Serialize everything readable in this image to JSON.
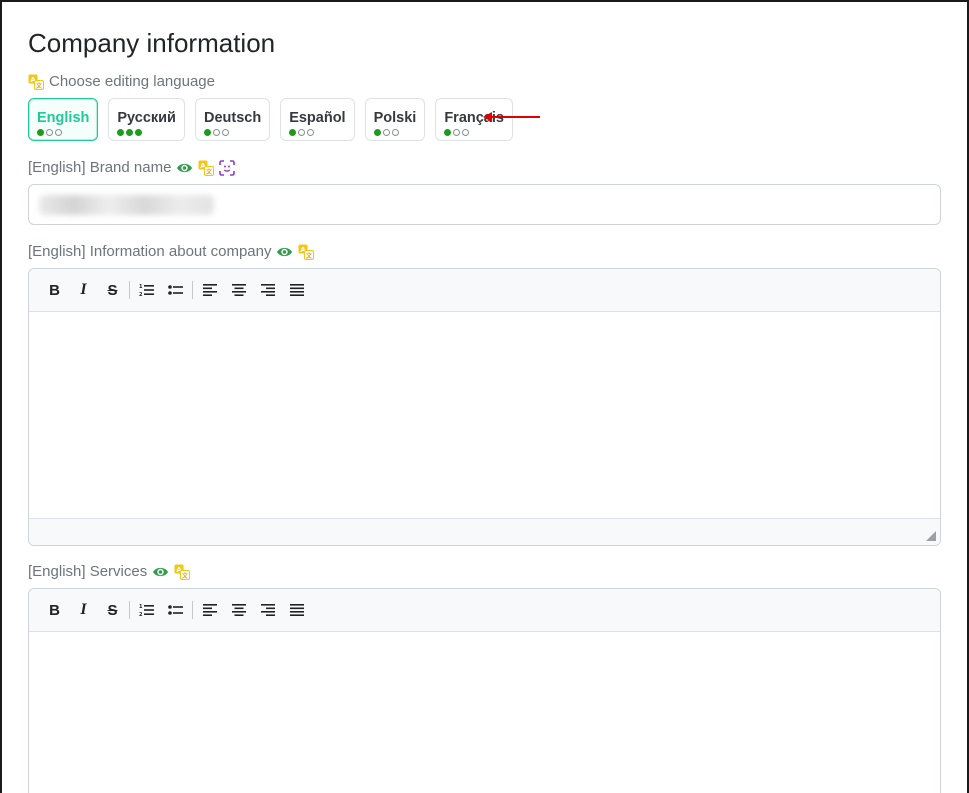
{
  "page": {
    "title": "Company information"
  },
  "language_picker": {
    "caption": "Choose editing language",
    "languages": [
      {
        "label": "English",
        "progress": 1,
        "active": true
      },
      {
        "label": "Русский",
        "progress": 3,
        "active": false
      },
      {
        "label": "Deutsch",
        "progress": 1,
        "active": false
      },
      {
        "label": "Español",
        "progress": 1,
        "active": false
      },
      {
        "label": "Polski",
        "progress": 1,
        "active": false
      },
      {
        "label": "Français",
        "progress": 1,
        "active": false
      }
    ],
    "progress_total": 3
  },
  "fields": {
    "brand_name": {
      "label": "[English] Brand name"
    },
    "about": {
      "label": "[English] Information about company"
    },
    "services": {
      "label": "[English] Services"
    }
  },
  "editor_toolbar": {
    "bold": "B",
    "italic": "I",
    "strike": "S"
  },
  "colors": {
    "accent": "#20c997",
    "progress_green": "#1e9a1e",
    "translate_yellow": "#e0b100",
    "eye_green": "#2e9e4a",
    "ai_purple": "#8a3ad1",
    "annotation_arrow": "#e00000"
  }
}
